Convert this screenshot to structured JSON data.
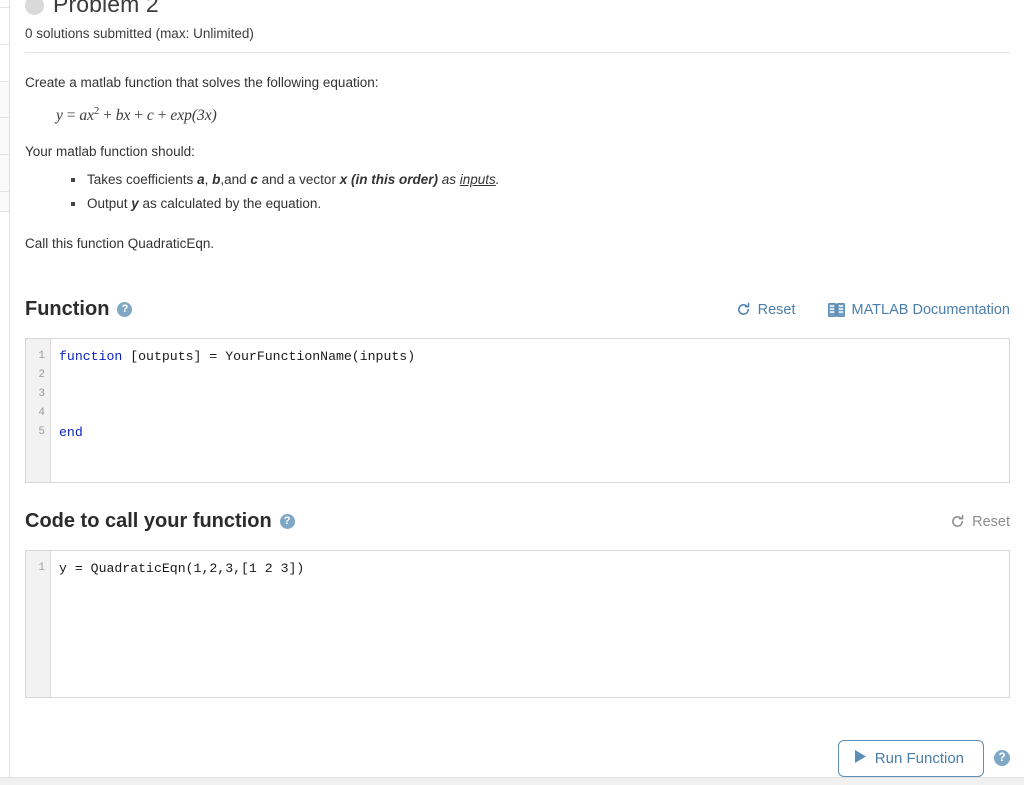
{
  "problem": {
    "title": "Problem 2",
    "status_icon": "circle-status-icon",
    "solutions_line": "0 solutions submitted (max: Unlimited)"
  },
  "statement": {
    "intro": "Create a matlab function that solves the following equation:",
    "equation": {
      "lhs": "y",
      "eq": "=",
      "term1_coef": "a",
      "term1_var": "x",
      "term1_exp": "2",
      "plus1": "+",
      "term2": "bx",
      "plus2": "+",
      "term3": "c",
      "plus3": "+",
      "term4": "exp(3x)",
      "plain": "y = ax² + bx + c + exp(3x)"
    },
    "should_line": "Your matlab function should:",
    "requirements": [
      {
        "pre": "Takes coefficients ",
        "a": "a",
        "sep1": ", ",
        "b": "b",
        "sep2": ",and ",
        "c": "c",
        "mid": " and a vector ",
        "x": "x (in this order)",
        "as": " as ",
        "inputs": "inputs",
        "end": "."
      },
      {
        "pre": "Output ",
        "y": "y",
        "post": " as calculated by the equation."
      }
    ],
    "call_line": "Call this function QuadraticEqn."
  },
  "function_section": {
    "title": "Function",
    "help_icon": "help-icon",
    "reset_label": "Reset",
    "reset_icon": "refresh-icon",
    "docs_label": "MATLAB Documentation",
    "docs_icon": "book-icon",
    "code_lines": [
      {
        "number": "1",
        "keyword": "function",
        "rest": " [outputs] = YourFunctionName(inputs)"
      },
      {
        "number": "2",
        "keyword": "",
        "rest": ""
      },
      {
        "number": "3",
        "keyword": "",
        "rest": ""
      },
      {
        "number": "4",
        "keyword": "",
        "rest": ""
      },
      {
        "number": "5",
        "keyword": "end",
        "rest": ""
      }
    ]
  },
  "call_section": {
    "title": "Code to call your function",
    "help_icon": "help-icon",
    "reset_label": "Reset",
    "reset_icon": "refresh-icon",
    "code_lines": [
      {
        "number": "1",
        "keyword": "",
        "rest": "y = QuadraticEqn(1,2,3,[1 2 3])"
      }
    ]
  },
  "run_bar": {
    "run_label": "Run Function",
    "play_icon": "play-icon",
    "help_icon": "help-icon"
  },
  "colors": {
    "link_blue": "#4a7fad",
    "muted_gray": "#8d8d8d",
    "keyword_blue": "#0b23c6",
    "help_blue": "#7fa8c6",
    "status_dot": "#d9d9d9"
  }
}
